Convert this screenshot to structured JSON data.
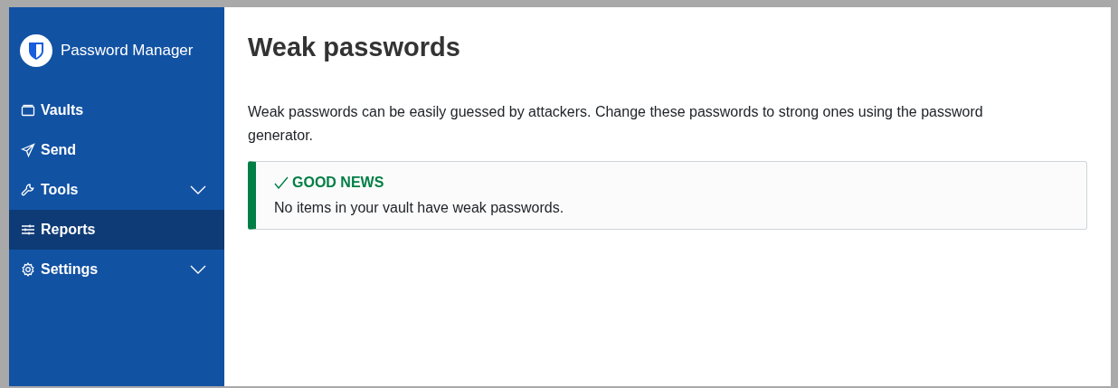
{
  "sidebar": {
    "product": "Password Manager",
    "items": [
      {
        "label": "Vaults",
        "selected": false,
        "expandable": false
      },
      {
        "label": "Send",
        "selected": false,
        "expandable": false
      },
      {
        "label": "Tools",
        "selected": false,
        "expandable": true
      },
      {
        "label": "Reports",
        "selected": true,
        "expandable": false
      },
      {
        "label": "Settings",
        "selected": false,
        "expandable": true
      }
    ]
  },
  "page": {
    "title": "Weak passwords",
    "description": "Weak passwords can be easily guessed by attackers. Change these passwords to strong ones using the password generator.",
    "callout": {
      "kind": "success",
      "title": "GOOD NEWS",
      "message": "No items in your vault have weak passwords."
    }
  }
}
